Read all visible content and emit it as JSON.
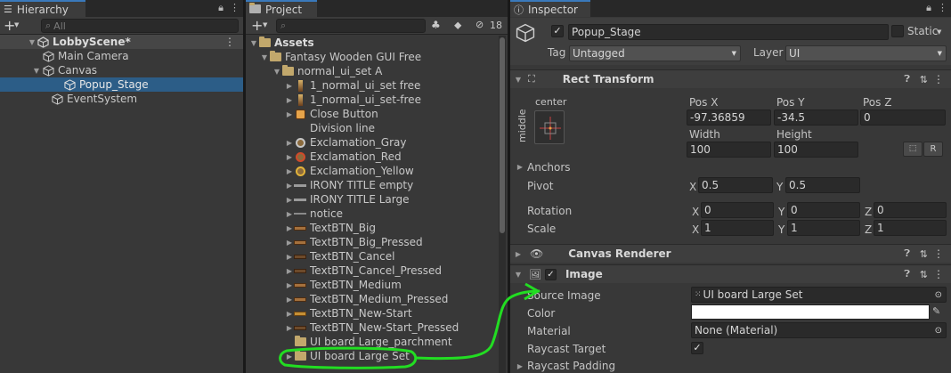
{
  "hierarchy": {
    "tab": "Hierarchy",
    "search_placeholder": "All",
    "add": "+",
    "items": [
      {
        "label": "LobbyScene*"
      },
      {
        "label": "Main Camera"
      },
      {
        "label": "Canvas"
      },
      {
        "label": "Popup_Stage"
      },
      {
        "label": "EventSystem"
      }
    ]
  },
  "project": {
    "tab": "Project",
    "add": "+",
    "hidden_count": "18",
    "items": [
      {
        "label": "Assets"
      },
      {
        "label": "Fantasy Wooden GUI  Free"
      },
      {
        "label": "normal_ui_set A"
      },
      {
        "label": "1_normal_ui_set free"
      },
      {
        "label": "1_normal_ui_set-free"
      },
      {
        "label": "Close Button"
      },
      {
        "label": "Division line"
      },
      {
        "label": "Exclamation_Gray"
      },
      {
        "label": "Exclamation_Red"
      },
      {
        "label": "Exclamation_Yellow"
      },
      {
        "label": "IRONY TITLE  empty"
      },
      {
        "label": "IRONY TITLE  Large"
      },
      {
        "label": "notice"
      },
      {
        "label": "TextBTN_Big"
      },
      {
        "label": "TextBTN_Big_Pressed"
      },
      {
        "label": "TextBTN_Cancel"
      },
      {
        "label": "TextBTN_Cancel_Pressed"
      },
      {
        "label": "TextBTN_Medium"
      },
      {
        "label": "TextBTN_Medium_Pressed"
      },
      {
        "label": "TextBTN_New-Start"
      },
      {
        "label": "TextBTN_New-Start_Pressed"
      },
      {
        "label": "UI board Large_parchment"
      },
      {
        "label": "UI board Large Set"
      }
    ]
  },
  "inspector": {
    "tab": "Inspector",
    "object_name": "Popup_Stage",
    "static_label": "Static",
    "tag_label": "Tag",
    "tag_value": "Untagged",
    "layer_label": "Layer",
    "layer_value": "UI",
    "rect_transform": {
      "title": "Rect Transform",
      "anchor_h": "center",
      "anchor_v": "middle",
      "pos_x_label": "Pos X",
      "pos_x": "-97.36859",
      "pos_y_label": "Pos Y",
      "pos_y": "-34.5",
      "pos_z_label": "Pos Z",
      "pos_z": "0",
      "width_label": "Width",
      "width": "100",
      "height_label": "Height",
      "height": "100",
      "r_button": "R",
      "anchors_label": "Anchors",
      "pivot_label": "Pivot",
      "pivot_x": "0.5",
      "pivot_y": "0.5",
      "rotation_label": "Rotation",
      "rot_x": "0",
      "rot_y": "0",
      "rot_z": "0",
      "scale_label": "Scale",
      "scale_x": "1",
      "scale_y": "1",
      "scale_z": "1",
      "x": "X",
      "y": "Y",
      "z": "Z"
    },
    "canvas_renderer": {
      "title": "Canvas Renderer"
    },
    "image": {
      "title": "Image",
      "source_label": "Source Image",
      "source_value": "UI board Large Set",
      "color_label": "Color",
      "material_label": "Material",
      "material_value": "None (Material)",
      "raycast_label": "Raycast Target",
      "padding_label": "Raycast Padding"
    }
  },
  "colors": {
    "selection": "#2c5d87",
    "annotation": "#22dd22",
    "accent": "#3a79bb"
  }
}
